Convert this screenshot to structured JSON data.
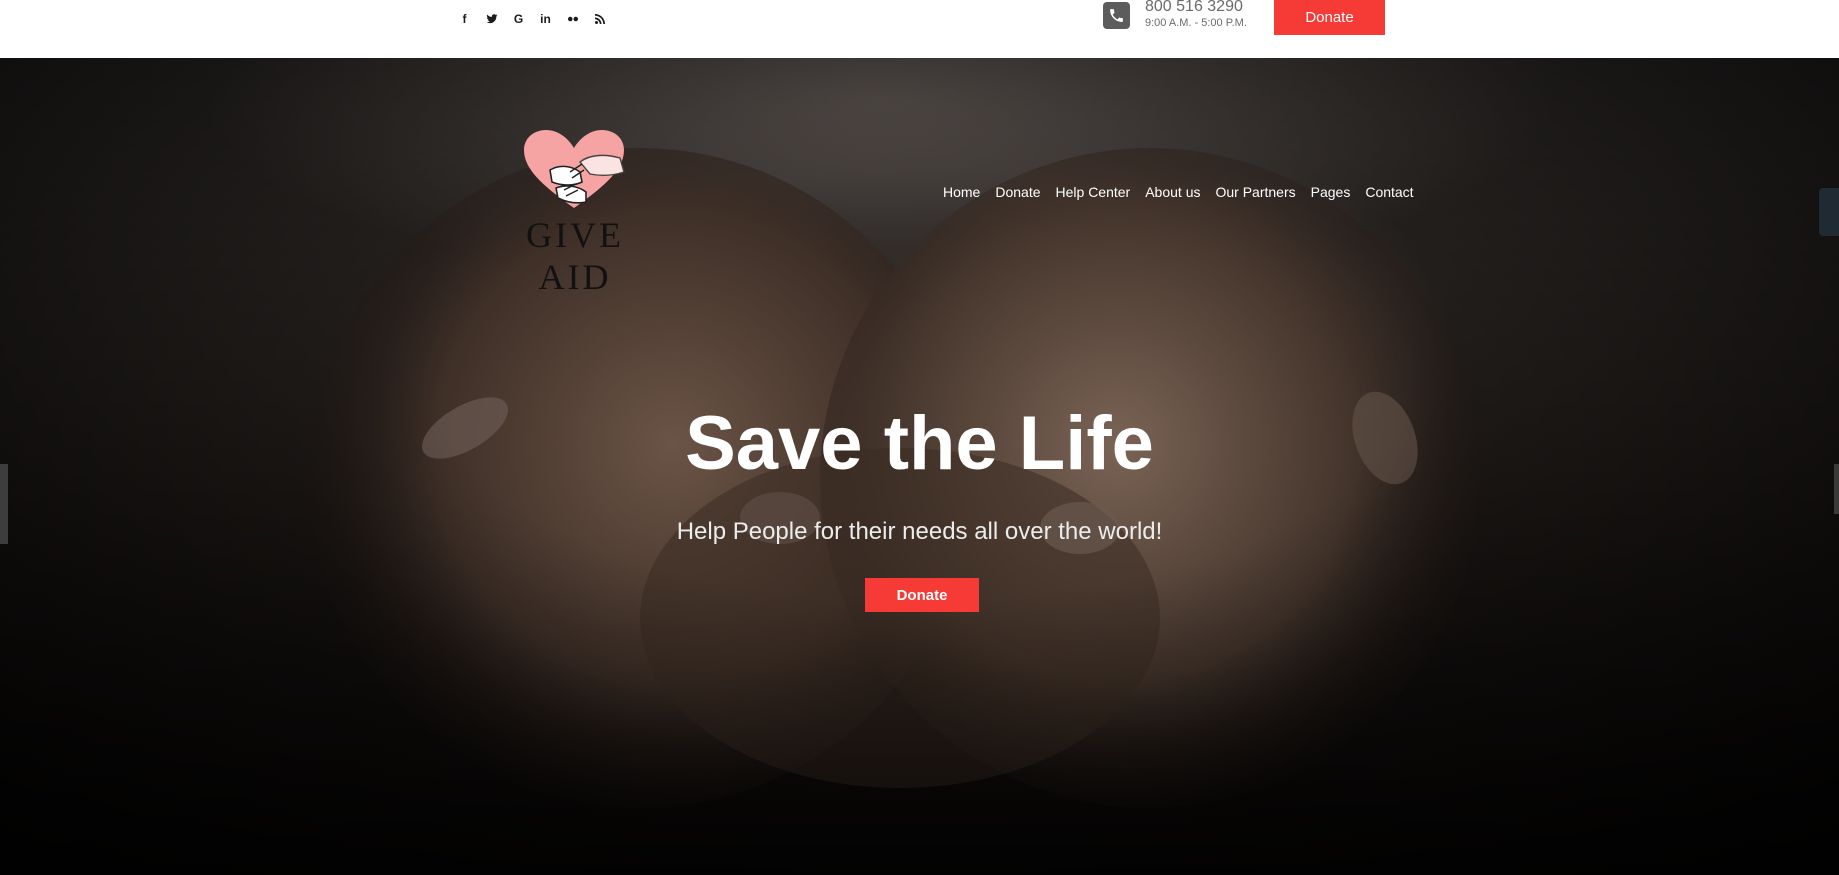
{
  "topbar": {
    "socials": [
      {
        "icon": "facebook-icon",
        "glyph": "f"
      },
      {
        "icon": "twitter-icon",
        "glyph": ""
      },
      {
        "icon": "google-icon",
        "glyph": "G"
      },
      {
        "icon": "linkedin-icon",
        "glyph": "in"
      },
      {
        "icon": "flickr-icon",
        "glyph": ""
      },
      {
        "icon": "rss-icon",
        "glyph": ""
      }
    ],
    "phone_icon": "phone-icon",
    "phone_number": "800 516 3290",
    "phone_hours": "9:00 A.M. - 5:00 P.M.",
    "donate_label": "Donate"
  },
  "logo": {
    "text": "GIVE AID",
    "icon": "heart-hands-icon"
  },
  "nav": {
    "items": [
      {
        "label": "Home"
      },
      {
        "label": "Donate"
      },
      {
        "label": "Help Center"
      },
      {
        "label": "About us"
      },
      {
        "label": "Our Partners"
      },
      {
        "label": "Pages"
      },
      {
        "label": "Contact"
      }
    ]
  },
  "hero": {
    "title": "Save the Life",
    "subtitle": "Help People for their needs all over the world!",
    "donate_label": "Donate"
  },
  "colors": {
    "accent": "#f63a35",
    "topbar_bg": "#ffffff",
    "logo_heart": "#f5a3a3"
  }
}
